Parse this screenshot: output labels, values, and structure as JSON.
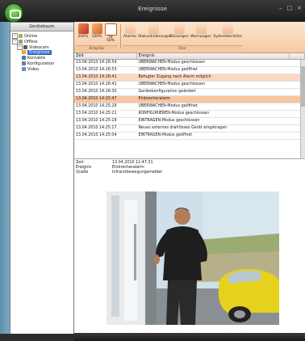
{
  "window": {
    "title": "Ereignisse",
    "controls": [
      "–",
      "□",
      "×"
    ]
  },
  "left_panel": {
    "header": "Gerätebaum",
    "tree": [
      {
        "label": "Online",
        "level": 0,
        "expander": "−",
        "icon": "globe-icon",
        "icon_color": "#8fbf3f"
      },
      {
        "label": "Offline",
        "level": 0,
        "expander": "−",
        "icon": "globe-icon",
        "icon_color": "#9a9a9a"
      },
      {
        "label": "Videocam",
        "level": 1,
        "expander": "−",
        "icon": "camera-icon",
        "icon_color": "#5b5b5b"
      },
      {
        "label": "Ereignisse",
        "level": 2,
        "expander": "",
        "icon": "bell-icon",
        "icon_color": "#f0a030",
        "selected": true
      },
      {
        "label": "Kontakte",
        "level": 2,
        "expander": "",
        "icon": "contacts-icon",
        "icon_color": "#4a78b8"
      },
      {
        "label": "Konfiguration",
        "level": 2,
        "expander": "",
        "icon": "config-icon",
        "icon_color": "#7a7a7a"
      },
      {
        "label": "Video",
        "level": 2,
        "expander": "",
        "icon": "video-icon",
        "icon_color": "#6a8ac0"
      }
    ]
  },
  "ribbon": {
    "group1": {
      "caption": "Bildgröße",
      "buttons": [
        {
          "label": "200%",
          "icon": "zoom-200-icon",
          "color": "#d24a2a"
        },
        {
          "label": "100%",
          "icon": "zoom-100-icon",
          "color": "#e07a3a"
        },
        {
          "label": "Fit\n50%",
          "icon": "zoom-50-icon",
          "color": "#ffffff"
        }
      ]
    },
    "group2": {
      "caption": "Filter",
      "buttons": [
        {
          "label": "Alarme",
          "icon": "alarm-filter-icon"
        },
        {
          "label": "Statusänderungen",
          "icon": "status-filter-icon"
        },
        {
          "label": "Störungen",
          "icon": "fault-filter-icon"
        },
        {
          "label": "Warnungen",
          "icon": "warning-filter-icon"
        },
        {
          "label": "Systemberichte",
          "icon": "system-filter-icon"
        }
      ]
    }
  },
  "events_table": {
    "columns": [
      "Zeit",
      "Ereignis"
    ],
    "rows": [
      {
        "time": "13.04.2010 14:26:54",
        "event": "ÜBERWACHEN-Modus geschlossen",
        "style": ""
      },
      {
        "time": "13.04.2010 14:26:53",
        "event": "ÜBERWACHEN-Modus geöffnet",
        "style": ""
      },
      {
        "time": "13.04.2010 14:26:41",
        "event": "Befugter Zugang nach Alarm möglich",
        "style": "alarm"
      },
      {
        "time": "13.04.2010 14:26:41",
        "event": "ÜBERWACHEN-Modus geschlossen",
        "style": ""
      },
      {
        "time": "13.04.2010 14:26:30",
        "event": "Gerätekonfiguration geändert",
        "style": ""
      },
      {
        "time": "13.04.2010 14:25:47",
        "event": "Einbrecheralarm",
        "style": "alarm2"
      },
      {
        "time": "13.04.2010 14:25:29",
        "event": "ÜBERWACHEN-Modus geöffnet",
        "style": ""
      },
      {
        "time": "13.04.2010 14:25:21",
        "event": "KONFIGURIEREN-Modus geschlossen",
        "style": ""
      },
      {
        "time": "13.04.2010 14:25:18",
        "event": "EINTRAGEN-Modus geschlossen",
        "style": ""
      },
      {
        "time": "13.04.2010 14:25:17",
        "event": "Neues externes drahtloses Gerät eingetragen",
        "style": ""
      },
      {
        "time": "13.04.2010 14:25:04",
        "event": "EINTRAGEN-Modus geöffnet",
        "style": ""
      }
    ],
    "row_marker": "..."
  },
  "details": {
    "time_label": "Zeit",
    "time_value": "13.04.2010 12:47:31",
    "event_label": "Ereignis",
    "event_value": "Einbrecheralarm",
    "source_label": "Quelle",
    "source_value": "Infrarotbewegungsmelder"
  },
  "colors": {
    "ribbon": "#f6c9a3",
    "selection": "#3168c5",
    "alarm_row": "#fbd8bf"
  }
}
